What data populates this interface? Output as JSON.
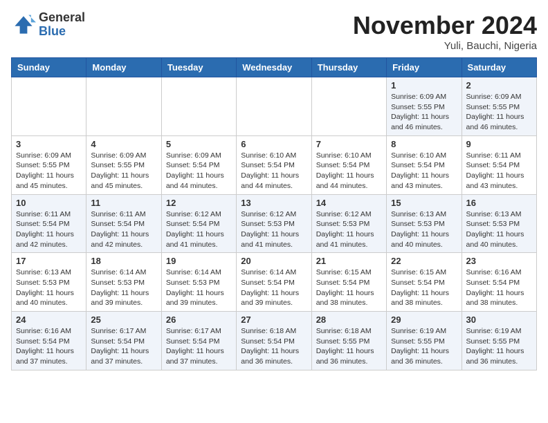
{
  "header": {
    "logo_line1": "General",
    "logo_line2": "Blue",
    "month_title": "November 2024",
    "location": "Yuli, Bauchi, Nigeria"
  },
  "weekdays": [
    "Sunday",
    "Monday",
    "Tuesday",
    "Wednesday",
    "Thursday",
    "Friday",
    "Saturday"
  ],
  "weeks": [
    [
      {
        "day": "",
        "info": ""
      },
      {
        "day": "",
        "info": ""
      },
      {
        "day": "",
        "info": ""
      },
      {
        "day": "",
        "info": ""
      },
      {
        "day": "",
        "info": ""
      },
      {
        "day": "1",
        "info": "Sunrise: 6:09 AM\nSunset: 5:55 PM\nDaylight: 11 hours\nand 46 minutes."
      },
      {
        "day": "2",
        "info": "Sunrise: 6:09 AM\nSunset: 5:55 PM\nDaylight: 11 hours\nand 46 minutes."
      }
    ],
    [
      {
        "day": "3",
        "info": "Sunrise: 6:09 AM\nSunset: 5:55 PM\nDaylight: 11 hours\nand 45 minutes."
      },
      {
        "day": "4",
        "info": "Sunrise: 6:09 AM\nSunset: 5:55 PM\nDaylight: 11 hours\nand 45 minutes."
      },
      {
        "day": "5",
        "info": "Sunrise: 6:09 AM\nSunset: 5:54 PM\nDaylight: 11 hours\nand 44 minutes."
      },
      {
        "day": "6",
        "info": "Sunrise: 6:10 AM\nSunset: 5:54 PM\nDaylight: 11 hours\nand 44 minutes."
      },
      {
        "day": "7",
        "info": "Sunrise: 6:10 AM\nSunset: 5:54 PM\nDaylight: 11 hours\nand 44 minutes."
      },
      {
        "day": "8",
        "info": "Sunrise: 6:10 AM\nSunset: 5:54 PM\nDaylight: 11 hours\nand 43 minutes."
      },
      {
        "day": "9",
        "info": "Sunrise: 6:11 AM\nSunset: 5:54 PM\nDaylight: 11 hours\nand 43 minutes."
      }
    ],
    [
      {
        "day": "10",
        "info": "Sunrise: 6:11 AM\nSunset: 5:54 PM\nDaylight: 11 hours\nand 42 minutes."
      },
      {
        "day": "11",
        "info": "Sunrise: 6:11 AM\nSunset: 5:54 PM\nDaylight: 11 hours\nand 42 minutes."
      },
      {
        "day": "12",
        "info": "Sunrise: 6:12 AM\nSunset: 5:54 PM\nDaylight: 11 hours\nand 41 minutes."
      },
      {
        "day": "13",
        "info": "Sunrise: 6:12 AM\nSunset: 5:53 PM\nDaylight: 11 hours\nand 41 minutes."
      },
      {
        "day": "14",
        "info": "Sunrise: 6:12 AM\nSunset: 5:53 PM\nDaylight: 11 hours\nand 41 minutes."
      },
      {
        "day": "15",
        "info": "Sunrise: 6:13 AM\nSunset: 5:53 PM\nDaylight: 11 hours\nand 40 minutes."
      },
      {
        "day": "16",
        "info": "Sunrise: 6:13 AM\nSunset: 5:53 PM\nDaylight: 11 hours\nand 40 minutes."
      }
    ],
    [
      {
        "day": "17",
        "info": "Sunrise: 6:13 AM\nSunset: 5:53 PM\nDaylight: 11 hours\nand 40 minutes."
      },
      {
        "day": "18",
        "info": "Sunrise: 6:14 AM\nSunset: 5:53 PM\nDaylight: 11 hours\nand 39 minutes."
      },
      {
        "day": "19",
        "info": "Sunrise: 6:14 AM\nSunset: 5:53 PM\nDaylight: 11 hours\nand 39 minutes."
      },
      {
        "day": "20",
        "info": "Sunrise: 6:14 AM\nSunset: 5:54 PM\nDaylight: 11 hours\nand 39 minutes."
      },
      {
        "day": "21",
        "info": "Sunrise: 6:15 AM\nSunset: 5:54 PM\nDaylight: 11 hours\nand 38 minutes."
      },
      {
        "day": "22",
        "info": "Sunrise: 6:15 AM\nSunset: 5:54 PM\nDaylight: 11 hours\nand 38 minutes."
      },
      {
        "day": "23",
        "info": "Sunrise: 6:16 AM\nSunset: 5:54 PM\nDaylight: 11 hours\nand 38 minutes."
      }
    ],
    [
      {
        "day": "24",
        "info": "Sunrise: 6:16 AM\nSunset: 5:54 PM\nDaylight: 11 hours\nand 37 minutes."
      },
      {
        "day": "25",
        "info": "Sunrise: 6:17 AM\nSunset: 5:54 PM\nDaylight: 11 hours\nand 37 minutes."
      },
      {
        "day": "26",
        "info": "Sunrise: 6:17 AM\nSunset: 5:54 PM\nDaylight: 11 hours\nand 37 minutes."
      },
      {
        "day": "27",
        "info": "Sunrise: 6:18 AM\nSunset: 5:54 PM\nDaylight: 11 hours\nand 36 minutes."
      },
      {
        "day": "28",
        "info": "Sunrise: 6:18 AM\nSunset: 5:55 PM\nDaylight: 11 hours\nand 36 minutes."
      },
      {
        "day": "29",
        "info": "Sunrise: 6:19 AM\nSunset: 5:55 PM\nDaylight: 11 hours\nand 36 minutes."
      },
      {
        "day": "30",
        "info": "Sunrise: 6:19 AM\nSunset: 5:55 PM\nDaylight: 11 hours\nand 36 minutes."
      }
    ]
  ]
}
